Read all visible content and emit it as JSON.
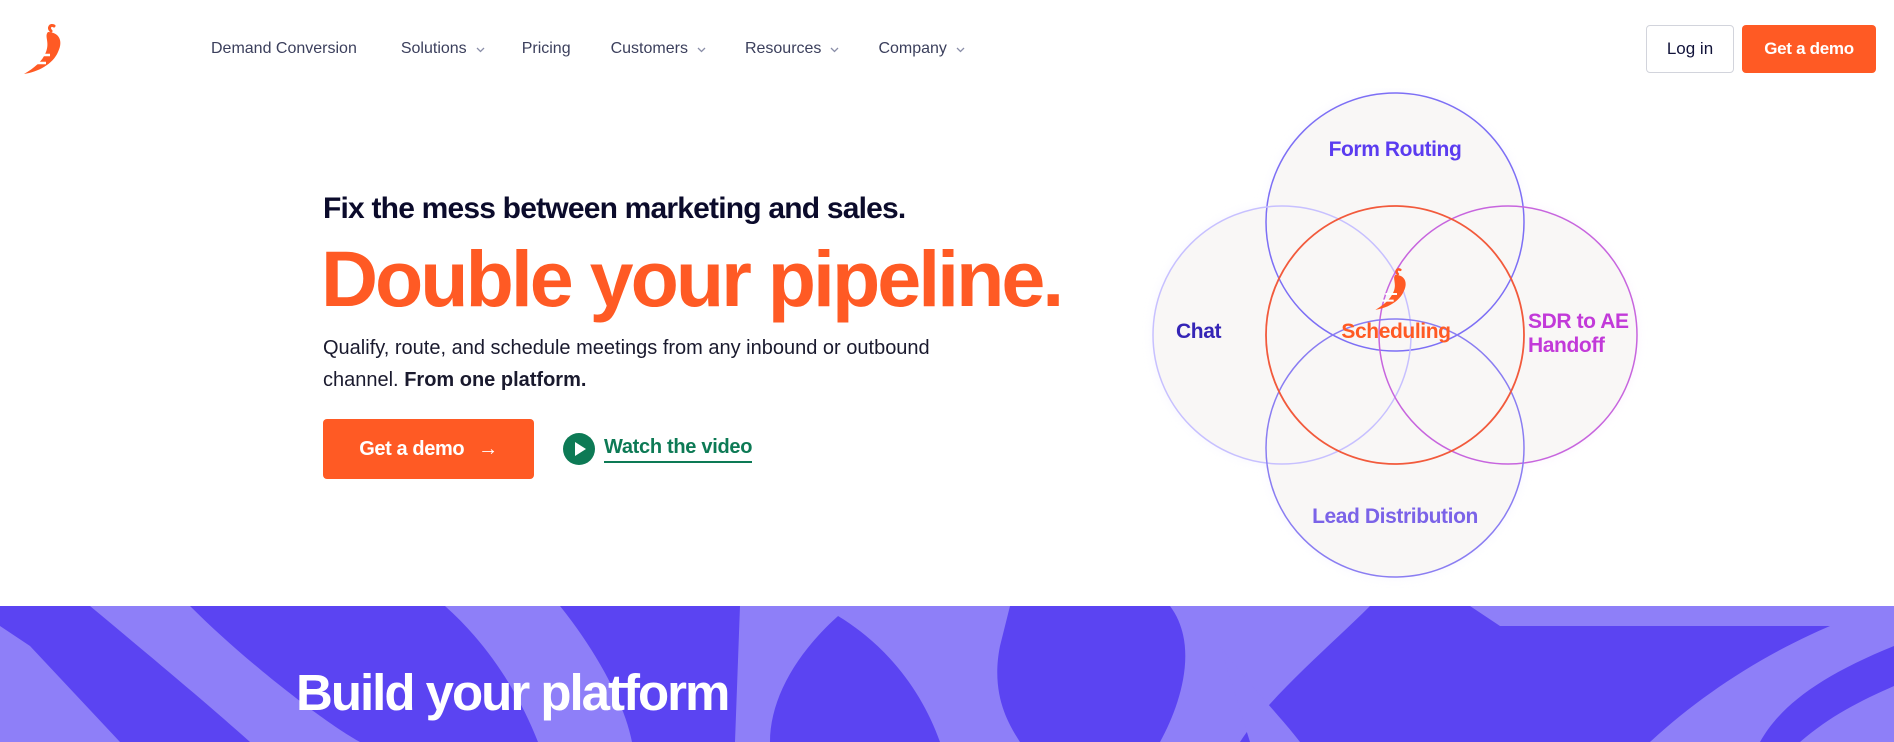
{
  "nav": {
    "items": [
      {
        "label": "Demand Conversion",
        "has_dropdown": false
      },
      {
        "label": "Solutions",
        "has_dropdown": true
      },
      {
        "label": "Pricing",
        "has_dropdown": false
      },
      {
        "label": "Customers",
        "has_dropdown": true
      },
      {
        "label": "Resources",
        "has_dropdown": true
      },
      {
        "label": "Company",
        "has_dropdown": true
      }
    ],
    "login_label": "Log in",
    "demo_label": "Get a demo"
  },
  "hero": {
    "eyebrow": "Fix the mess between marketing and sales.",
    "headline": "Double your pipeline.",
    "sub_text": "Qualify, route, and schedule meetings from any inbound or outbound channel.",
    "sub_bold": "From one platform.",
    "cta_label": "Get a demo",
    "cta_icon": "arrow-right-icon",
    "video_label": "Watch the video",
    "video_icon": "play-icon"
  },
  "venn": {
    "top": "Form Routing",
    "left": "Chat",
    "center": "Scheduling",
    "right": "SDR to AE Handoff",
    "bottom": "Lead Distribution"
  },
  "band": {
    "title": "Build your platform"
  },
  "colors": {
    "brand_orange": "#ff5a24",
    "purple": "#5b44f2",
    "green": "#0d7a55",
    "magenta": "#c23ad9"
  }
}
